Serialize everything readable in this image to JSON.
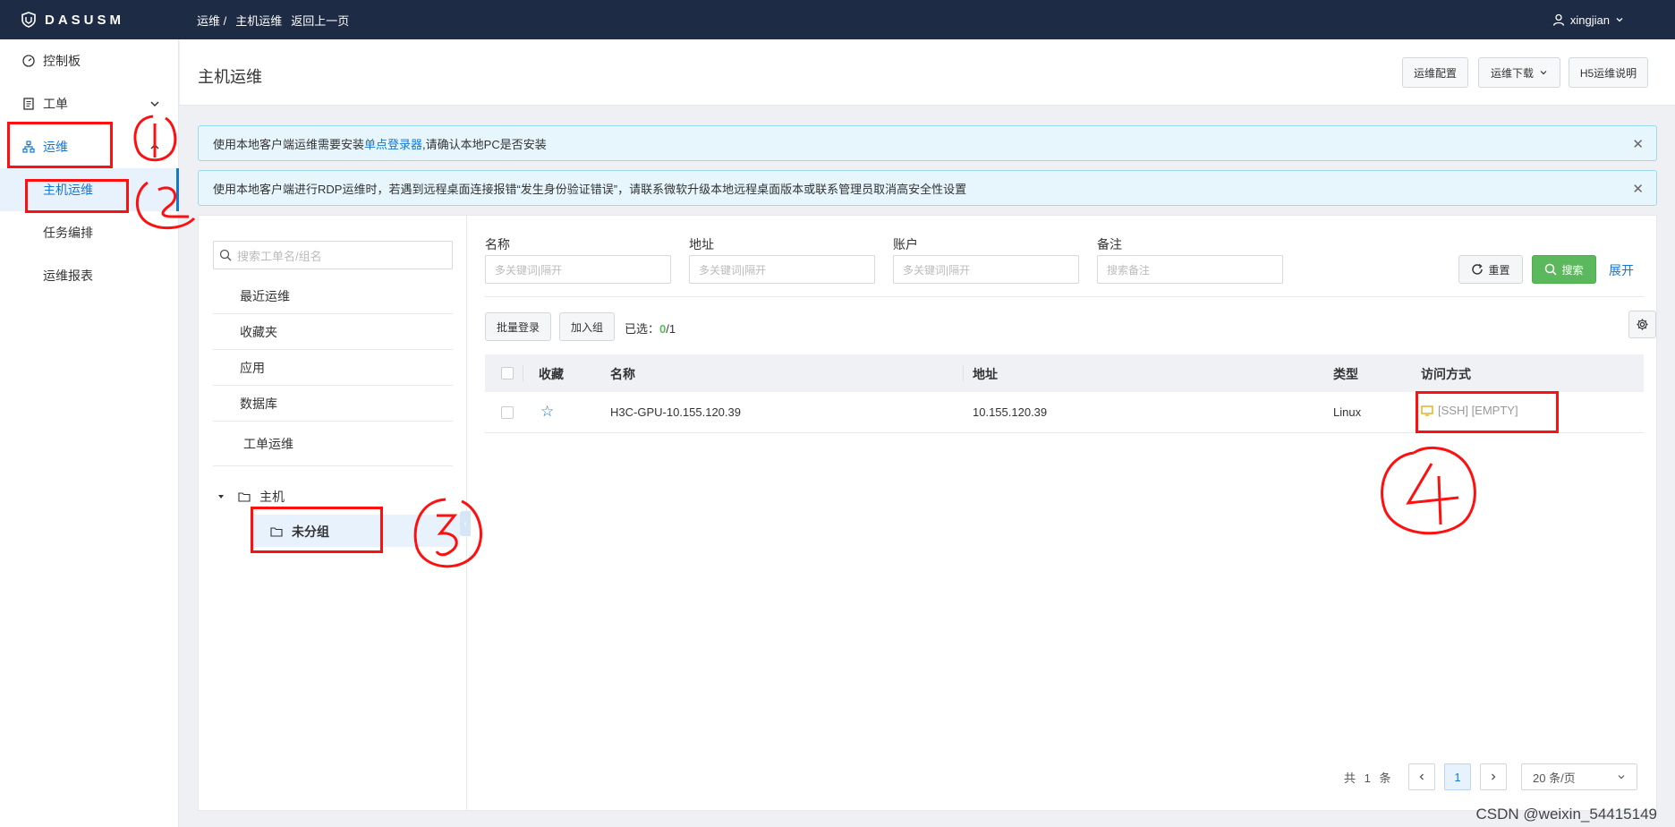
{
  "topbar": {
    "logo_text": "DASUSM",
    "breadcrumb": [
      "运维 /",
      "主机运维",
      "返回上一页"
    ],
    "user": "xingjian"
  },
  "sidebar": {
    "items": [
      {
        "label": "控制板",
        "icon": "dashboard-icon"
      },
      {
        "label": "工单",
        "icon": "ticket-icon"
      },
      {
        "label": "运维",
        "icon": "network-icon"
      }
    ],
    "sub_items": [
      "主机运维",
      "任务编排",
      "运维报表"
    ]
  },
  "header": {
    "title": "主机运维",
    "buttons": [
      "运维配置",
      "运维下载",
      "H5运维说明"
    ]
  },
  "alerts": [
    {
      "prefix": "使用本地客户端运维需要安装",
      "link": "单点登录器",
      "suffix": ",请确认本地PC是否安装"
    },
    {
      "text": "使用本地客户端进行RDP运维时，若遇到远程桌面连接报错“发生身份验证错误”，请联系微软升级本地远程桌面版本或联系管理员取消高安全性设置"
    }
  ],
  "tree": {
    "search_placeholder": "搜索工单名/组名",
    "links": [
      "最近运维",
      "收藏夹",
      "应用",
      "数据库",
      "工单运维"
    ],
    "root": "主机",
    "child": "未分组"
  },
  "filters": [
    {
      "label": "名称",
      "placeholder": "多关键词|隔开"
    },
    {
      "label": "地址",
      "placeholder": "多关键词|隔开"
    },
    {
      "label": "账户",
      "placeholder": "多关键词|隔开"
    },
    {
      "label": "备注",
      "placeholder": "搜索备注"
    }
  ],
  "actions": {
    "reset": "重置",
    "search": "搜索",
    "expand": "展开",
    "batch_login": "批量登录",
    "join_group": "加入组",
    "selected_label": "已选：",
    "selected_count": "0",
    "selected_total": "/1"
  },
  "table": {
    "columns": [
      "收藏",
      "名称",
      "地址",
      "类型",
      "访问方式"
    ],
    "rows": [
      {
        "name": "H3C-GPU-10.155.120.39",
        "address": "10.155.120.39",
        "type": "Linux",
        "access": "[SSH] [EMPTY]"
      }
    ]
  },
  "pagination": {
    "total_prefix": "共",
    "total": "1",
    "total_suffix": "条",
    "current_page": "1",
    "page_size": "20 条/页"
  },
  "annotations": [
    "1",
    "2",
    "3",
    "4"
  ],
  "watermark": "CSDN @weixin_54415149",
  "colors": {
    "primary": "#1677d2",
    "topbar": "#1d2b45",
    "annotation": "#ff1010",
    "success": "#5cb85c"
  }
}
